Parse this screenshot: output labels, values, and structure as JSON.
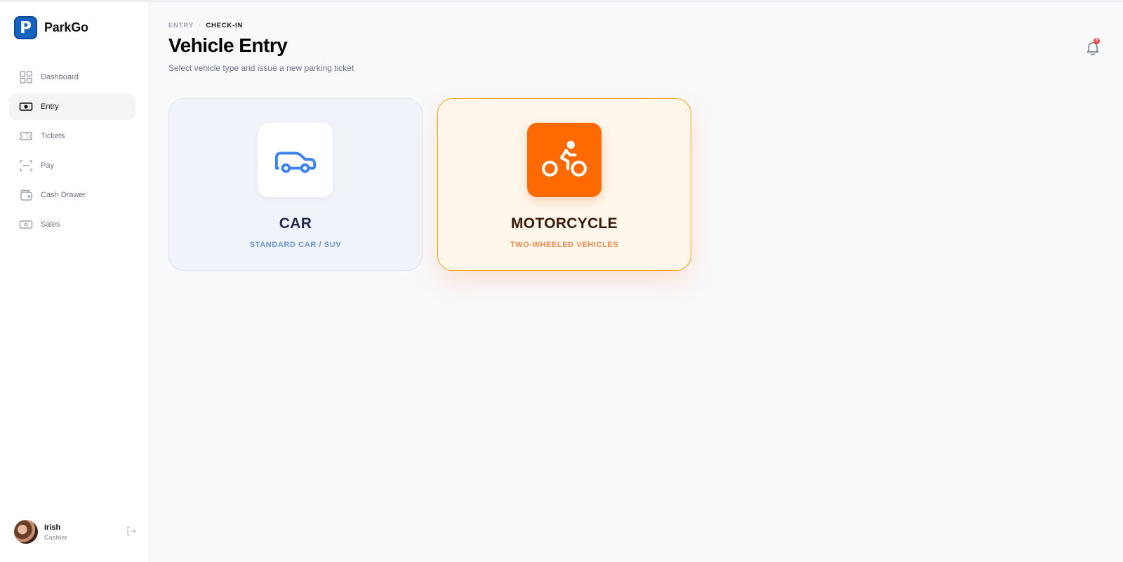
{
  "app": {
    "name": "ParkGo",
    "logo_letter": "P"
  },
  "sidebar": {
    "items": [
      {
        "label": "Dashboard",
        "icon": "grid-icon",
        "active": false
      },
      {
        "label": "Entry",
        "icon": "ticket-cash-icon",
        "active": true
      },
      {
        "label": "Tickets",
        "icon": "ticket-icon",
        "active": false
      },
      {
        "label": "Pay",
        "icon": "scan-icon",
        "active": false
      },
      {
        "label": "Cash Drawer",
        "icon": "wallet-icon",
        "active": false
      },
      {
        "label": "Sales",
        "icon": "banknote-icon",
        "active": false
      }
    ]
  },
  "user": {
    "name": "Irish",
    "role": "Cashier"
  },
  "header": {
    "breadcrumb": [
      "ENTRY",
      "/",
      "CHECK-IN"
    ],
    "title": "Vehicle Entry",
    "subtitle": "Select vehicle type and issue a new parking ticket",
    "notification_count": "6"
  },
  "vehicle_types": [
    {
      "title": "CAR",
      "subtitle": "STANDARD CAR / SUV",
      "icon": "car-icon",
      "selected": false
    },
    {
      "title": "MOTORCYCLE",
      "subtitle": "TWO-WHEELED VEHICLES",
      "icon": "motorcycle-icon",
      "selected": true
    }
  ],
  "colors": {
    "brand": "#1565c0",
    "accent_orange": "#ff6a00",
    "car_blue": "#3b82f6",
    "notification_red": "#ef4444"
  }
}
